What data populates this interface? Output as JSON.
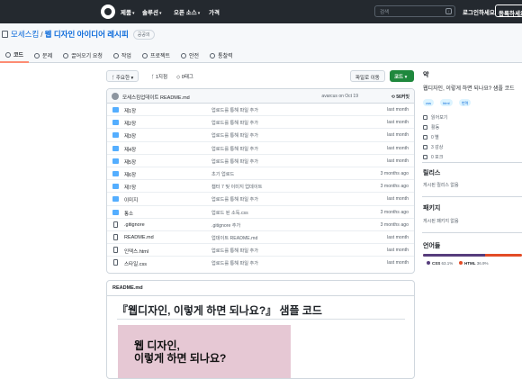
{
  "topbar": {
    "nav": [
      "제품",
      "솔루션",
      "오픈 소스",
      "가격"
    ],
    "search_placeholder": "검색",
    "search_shortcut": "/",
    "signin": "로그인하세요",
    "signup": "등록하세요"
  },
  "repo": {
    "owner": "모세스킴",
    "name": "웹 디자인 아이디어 레시피",
    "visibility": "공공의",
    "tabs": [
      "코드",
      "문제",
      "끌어오기 요청",
      "작업",
      "프로젝트",
      "안전",
      "통찰력"
    ]
  },
  "toolbar": {
    "branch": "주요한",
    "branch_caret": "▾",
    "branches": "1지점",
    "tags": "0태그",
    "go_to_file": "파일로 이동",
    "code": "코드",
    "code_caret": "▾"
  },
  "commit": {
    "message": "모세스킴업데이트 README.md",
    "meta": "avarcus   on Oct 19",
    "count": "56커밋"
  },
  "files": [
    {
      "type": "folder",
      "name": "제1장",
      "message": "업로드를 통해 파일 추가",
      "age": "last month"
    },
    {
      "type": "folder",
      "name": "제2장",
      "message": "업로드를 통해 파일 추가",
      "age": "last month"
    },
    {
      "type": "folder",
      "name": "제3장",
      "message": "업로드를 통해 파일 추가",
      "age": "last month"
    },
    {
      "type": "folder",
      "name": "제4장",
      "message": "업로드를 통해 파일 추가",
      "age": "last month"
    },
    {
      "type": "folder",
      "name": "제5장",
      "message": "업로드를 통해 파일 추가",
      "age": "last month"
    },
    {
      "type": "folder",
      "name": "제6장",
      "message": "초기 업로드",
      "age": "3 months ago"
    },
    {
      "type": "folder",
      "name": "제7장",
      "message": "챕터 7 및 이미지 업데이트",
      "age": "3 months ago"
    },
    {
      "type": "folder",
      "name": "이미지",
      "message": "업로드를 통해 파일 추가",
      "age": "last month"
    },
    {
      "type": "folder",
      "name": "통소",
      "message": "업로드 된 소독.css",
      "age": "3 months ago"
    },
    {
      "type": "file",
      "name": ".gitignore",
      "message": ".gitignore 추가",
      "age": "3 months ago"
    },
    {
      "type": "file",
      "name": "README.md",
      "message": "업데이트 README.md",
      "age": "last month"
    },
    {
      "type": "file",
      "name": "인덱스.html",
      "message": "업로드를 통해 파일 추가",
      "age": "last month"
    },
    {
      "type": "file",
      "name": "스타일.css",
      "message": "업로드를 통해 파일 추가",
      "age": "last month"
    }
  ],
  "readme": {
    "filename": "README.md",
    "title": "『웹디자인, 이렇게 하면 되나요?』 샘플 코드",
    "cover_line1": "웹 디자인,",
    "cover_line2": "이렇게 하면 되나요?"
  },
  "sidebar": {
    "about_heading": "약",
    "description": "웹디자인, 이렇게 하면 되나요? 샘플 코드",
    "topics": [
      "css",
      "html",
      "번역"
    ],
    "readme_link": "읽어보기",
    "activity": "활동",
    "stars": "0 별",
    "watching": "3 감상",
    "forks": "0 포크",
    "releases_heading": "릴리스",
    "releases_text": "게시된 릴리스 없음",
    "packages_heading": "패키지",
    "packages_text": "게시된 패키지 없음",
    "languages_heading": "언어들",
    "languages": [
      {
        "name": "CSS",
        "percent": "63.1%",
        "value": 63.1,
        "color": "#563d7c"
      },
      {
        "name": "HTML",
        "percent": "36.9%",
        "value": 36.9,
        "color": "#e34c26"
      }
    ]
  }
}
